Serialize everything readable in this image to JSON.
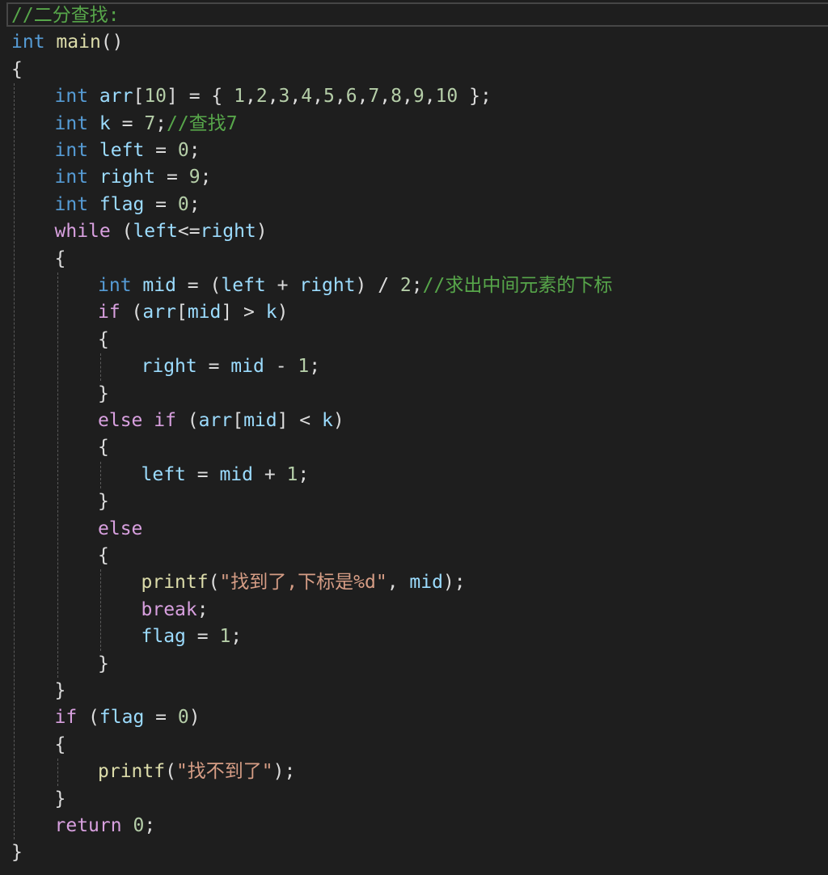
{
  "code": {
    "lines": [
      {
        "indent": 0,
        "tokens": [
          [
            "comment",
            "//二分查找:"
          ]
        ]
      },
      {
        "indent": 0,
        "tokens": [
          [
            "kw-type",
            "int"
          ],
          [
            "punc",
            " "
          ],
          [
            "fn",
            "main"
          ],
          [
            "punc",
            "()"
          ]
        ]
      },
      {
        "indent": 0,
        "tokens": [
          [
            "punc",
            "{"
          ]
        ]
      },
      {
        "indent": 1,
        "tokens": [
          [
            "kw-type",
            "int"
          ],
          [
            "punc",
            " "
          ],
          [
            "var",
            "arr"
          ],
          [
            "punc",
            "["
          ],
          [
            "num",
            "10"
          ],
          [
            "punc",
            "] = { "
          ],
          [
            "num",
            "1"
          ],
          [
            "punc",
            ","
          ],
          [
            "num",
            "2"
          ],
          [
            "punc",
            ","
          ],
          [
            "num",
            "3"
          ],
          [
            "punc",
            ","
          ],
          [
            "num",
            "4"
          ],
          [
            "punc",
            ","
          ],
          [
            "num",
            "5"
          ],
          [
            "punc",
            ","
          ],
          [
            "num",
            "6"
          ],
          [
            "punc",
            ","
          ],
          [
            "num",
            "7"
          ],
          [
            "punc",
            ","
          ],
          [
            "num",
            "8"
          ],
          [
            "punc",
            ","
          ],
          [
            "num",
            "9"
          ],
          [
            "punc",
            ","
          ],
          [
            "num",
            "10"
          ],
          [
            "punc",
            " };"
          ]
        ]
      },
      {
        "indent": 1,
        "tokens": [
          [
            "kw-type",
            "int"
          ],
          [
            "punc",
            " "
          ],
          [
            "var",
            "k"
          ],
          [
            "punc",
            " = "
          ],
          [
            "num",
            "7"
          ],
          [
            "punc",
            ";"
          ],
          [
            "comment",
            "//查找7"
          ]
        ]
      },
      {
        "indent": 1,
        "tokens": [
          [
            "kw-type",
            "int"
          ],
          [
            "punc",
            " "
          ],
          [
            "var",
            "left"
          ],
          [
            "punc",
            " = "
          ],
          [
            "num",
            "0"
          ],
          [
            "punc",
            ";"
          ]
        ]
      },
      {
        "indent": 1,
        "tokens": [
          [
            "kw-type",
            "int"
          ],
          [
            "punc",
            " "
          ],
          [
            "var",
            "right"
          ],
          [
            "punc",
            " = "
          ],
          [
            "num",
            "9"
          ],
          [
            "punc",
            ";"
          ]
        ]
      },
      {
        "indent": 1,
        "tokens": [
          [
            "kw-type",
            "int"
          ],
          [
            "punc",
            " "
          ],
          [
            "var",
            "flag"
          ],
          [
            "punc",
            " = "
          ],
          [
            "num",
            "0"
          ],
          [
            "punc",
            ";"
          ]
        ]
      },
      {
        "indent": 1,
        "tokens": [
          [
            "kw-ctrl",
            "while"
          ],
          [
            "punc",
            " ("
          ],
          [
            "var",
            "left"
          ],
          [
            "punc",
            "<="
          ],
          [
            "var",
            "right"
          ],
          [
            "punc",
            ")"
          ]
        ]
      },
      {
        "indent": 1,
        "tokens": [
          [
            "punc",
            "{"
          ]
        ]
      },
      {
        "indent": 2,
        "tokens": [
          [
            "kw-type",
            "int"
          ],
          [
            "punc",
            " "
          ],
          [
            "var",
            "mid"
          ],
          [
            "punc",
            " = ("
          ],
          [
            "var",
            "left"
          ],
          [
            "punc",
            " + "
          ],
          [
            "var",
            "right"
          ],
          [
            "punc",
            ") / "
          ],
          [
            "num",
            "2"
          ],
          [
            "punc",
            ";"
          ],
          [
            "comment",
            "//求出中间元素的下标"
          ]
        ]
      },
      {
        "indent": 2,
        "tokens": [
          [
            "kw-ctrl",
            "if"
          ],
          [
            "punc",
            " ("
          ],
          [
            "var",
            "arr"
          ],
          [
            "punc",
            "["
          ],
          [
            "var",
            "mid"
          ],
          [
            "punc",
            "] > "
          ],
          [
            "var",
            "k"
          ],
          [
            "punc",
            ")"
          ]
        ]
      },
      {
        "indent": 2,
        "tokens": [
          [
            "punc",
            "{"
          ]
        ]
      },
      {
        "indent": 3,
        "tokens": [
          [
            "var",
            "right"
          ],
          [
            "punc",
            " = "
          ],
          [
            "var",
            "mid"
          ],
          [
            "punc",
            " - "
          ],
          [
            "num",
            "1"
          ],
          [
            "punc",
            ";"
          ]
        ]
      },
      {
        "indent": 2,
        "tokens": [
          [
            "punc",
            "}"
          ]
        ]
      },
      {
        "indent": 2,
        "tokens": [
          [
            "kw-ctrl",
            "else"
          ],
          [
            "punc",
            " "
          ],
          [
            "kw-ctrl",
            "if"
          ],
          [
            "punc",
            " ("
          ],
          [
            "var",
            "arr"
          ],
          [
            "punc",
            "["
          ],
          [
            "var",
            "mid"
          ],
          [
            "punc",
            "] < "
          ],
          [
            "var",
            "k"
          ],
          [
            "punc",
            ")"
          ]
        ]
      },
      {
        "indent": 2,
        "tokens": [
          [
            "punc",
            "{"
          ]
        ]
      },
      {
        "indent": 3,
        "tokens": [
          [
            "var",
            "left"
          ],
          [
            "punc",
            " = "
          ],
          [
            "var",
            "mid"
          ],
          [
            "punc",
            " + "
          ],
          [
            "num",
            "1"
          ],
          [
            "punc",
            ";"
          ]
        ]
      },
      {
        "indent": 2,
        "tokens": [
          [
            "punc",
            "}"
          ]
        ]
      },
      {
        "indent": 2,
        "tokens": [
          [
            "kw-ctrl",
            "else"
          ]
        ]
      },
      {
        "indent": 2,
        "tokens": [
          [
            "punc",
            "{"
          ]
        ]
      },
      {
        "indent": 3,
        "tokens": [
          [
            "fn",
            "printf"
          ],
          [
            "punc",
            "("
          ],
          [
            "str",
            "\"找到了,下标是%d\""
          ],
          [
            "punc",
            ", "
          ],
          [
            "var",
            "mid"
          ],
          [
            "punc",
            ");"
          ]
        ]
      },
      {
        "indent": 3,
        "tokens": [
          [
            "kw-ctrl",
            "break"
          ],
          [
            "punc",
            ";"
          ]
        ]
      },
      {
        "indent": 3,
        "tokens": [
          [
            "var",
            "flag"
          ],
          [
            "punc",
            " = "
          ],
          [
            "num",
            "1"
          ],
          [
            "punc",
            ";"
          ]
        ]
      },
      {
        "indent": 2,
        "tokens": [
          [
            "punc",
            "}"
          ]
        ]
      },
      {
        "indent": 1,
        "tokens": [
          [
            "punc",
            "}"
          ]
        ]
      },
      {
        "indent": 1,
        "tokens": [
          [
            "kw-ctrl",
            "if"
          ],
          [
            "punc",
            " ("
          ],
          [
            "var",
            "flag"
          ],
          [
            "punc",
            " = "
          ],
          [
            "num",
            "0"
          ],
          [
            "punc",
            ")"
          ]
        ]
      },
      {
        "indent": 1,
        "tokens": [
          [
            "punc",
            "{"
          ]
        ]
      },
      {
        "indent": 2,
        "tokens": [
          [
            "fn",
            "printf"
          ],
          [
            "punc",
            "("
          ],
          [
            "str",
            "\"找不到了\""
          ],
          [
            "punc",
            ");"
          ]
        ]
      },
      {
        "indent": 1,
        "tokens": [
          [
            "punc",
            "}"
          ]
        ]
      },
      {
        "indent": 1,
        "tokens": [
          [
            "kw-ctrl",
            "return"
          ],
          [
            "punc",
            " "
          ],
          [
            "num",
            "0"
          ],
          [
            "punc",
            ";"
          ]
        ]
      },
      {
        "indent": 0,
        "tokens": [
          [
            "punc",
            "}"
          ]
        ]
      }
    ]
  },
  "guides": [
    {
      "level": 0,
      "from": 3,
      "to": 30
    },
    {
      "level": 1,
      "from": 10,
      "to": 24
    },
    {
      "level": 1,
      "from": 28,
      "to": 28
    },
    {
      "level": 2,
      "from": 13,
      "to": 13
    },
    {
      "level": 2,
      "from": 17,
      "to": 17
    },
    {
      "level": 2,
      "from": 21,
      "to": 23
    }
  ]
}
